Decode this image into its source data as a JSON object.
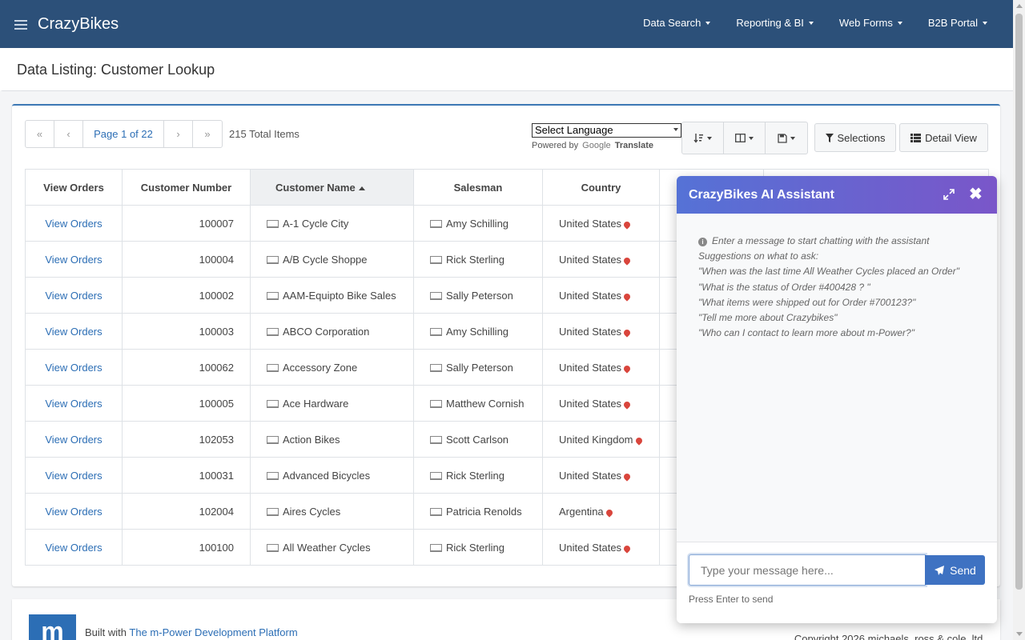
{
  "nav": {
    "brand": "CrazyBikes",
    "menu": [
      "Data Search",
      "Reporting & BI",
      "Web Forms",
      "B2B Portal"
    ]
  },
  "page": {
    "title": "Data Listing: Customer Lookup"
  },
  "pager": {
    "first": "«",
    "prev": "‹",
    "info": "Page 1 of 22",
    "next": "›",
    "last": "»",
    "total": "215 Total Items"
  },
  "translate": {
    "select": "Select Language",
    "powered_by": "Powered by",
    "google": "Google",
    "translate": "Translate"
  },
  "buttons": {
    "selections": "Selections",
    "detail_view": "Detail View"
  },
  "table": {
    "headers": [
      "View Orders",
      "Customer Number",
      "Customer Name",
      "Salesman",
      "Country"
    ],
    "rows": [
      {
        "link": "View Orders",
        "num": "100007",
        "name": "A-1 Cycle City",
        "sales": "Amy Schilling",
        "country": "United States"
      },
      {
        "link": "View Orders",
        "num": "100004",
        "name": "A/B Cycle Shoppe",
        "sales": "Rick Sterling",
        "country": "United States"
      },
      {
        "link": "View Orders",
        "num": "100002",
        "name": "AAM-Equipto Bike Sales",
        "sales": "Sally Peterson",
        "country": "United States"
      },
      {
        "link": "View Orders",
        "num": "100003",
        "name": "ABCO Corporation",
        "sales": "Amy Schilling",
        "country": "United States"
      },
      {
        "link": "View Orders",
        "num": "100062",
        "name": "Accessory Zone",
        "sales": "Sally Peterson",
        "country": "United States"
      },
      {
        "link": "View Orders",
        "num": "100005",
        "name": "Ace Hardware",
        "sales": "Matthew Cornish",
        "country": "United States"
      },
      {
        "link": "View Orders",
        "num": "102053",
        "name": "Action Bikes",
        "sales": "Scott Carlson",
        "country": "United Kingdom"
      },
      {
        "link": "View Orders",
        "num": "100031",
        "name": "Advanced Bicycles",
        "sales": "Rick Sterling",
        "country": "United States"
      },
      {
        "link": "View Orders",
        "num": "102004",
        "name": "Aires Cycles",
        "sales": "Patricia Renolds",
        "country": "Argentina"
      },
      {
        "link": "View Orders",
        "num": "100100",
        "name": "All Weather Cycles",
        "sales": "Rick Sterling",
        "country": "United States"
      }
    ]
  },
  "footer": {
    "logo": "m",
    "built_with": "Built with",
    "platform": "The m-Power Development Platform",
    "copyright": "Copyright 2026 michaels, ross & cole, ltd."
  },
  "chat": {
    "title": "CrazyBikes AI Assistant",
    "intro": "Enter a message to start chatting with the assistant",
    "suggest_heading": "Suggestions on what to ask:",
    "suggestions": [
      "\"When was the last time All Weather Cycles placed an Order\"",
      "\"What is the status of Order #400428 ? \"",
      "\"What items were shipped out for Order #700123?\"",
      "\"Tell me more about Crazybikes\"",
      "\"Who can I contact to learn more about m-Power?\""
    ],
    "placeholder": "Type your message here...",
    "send": "Send",
    "hint": "Press Enter to send"
  }
}
